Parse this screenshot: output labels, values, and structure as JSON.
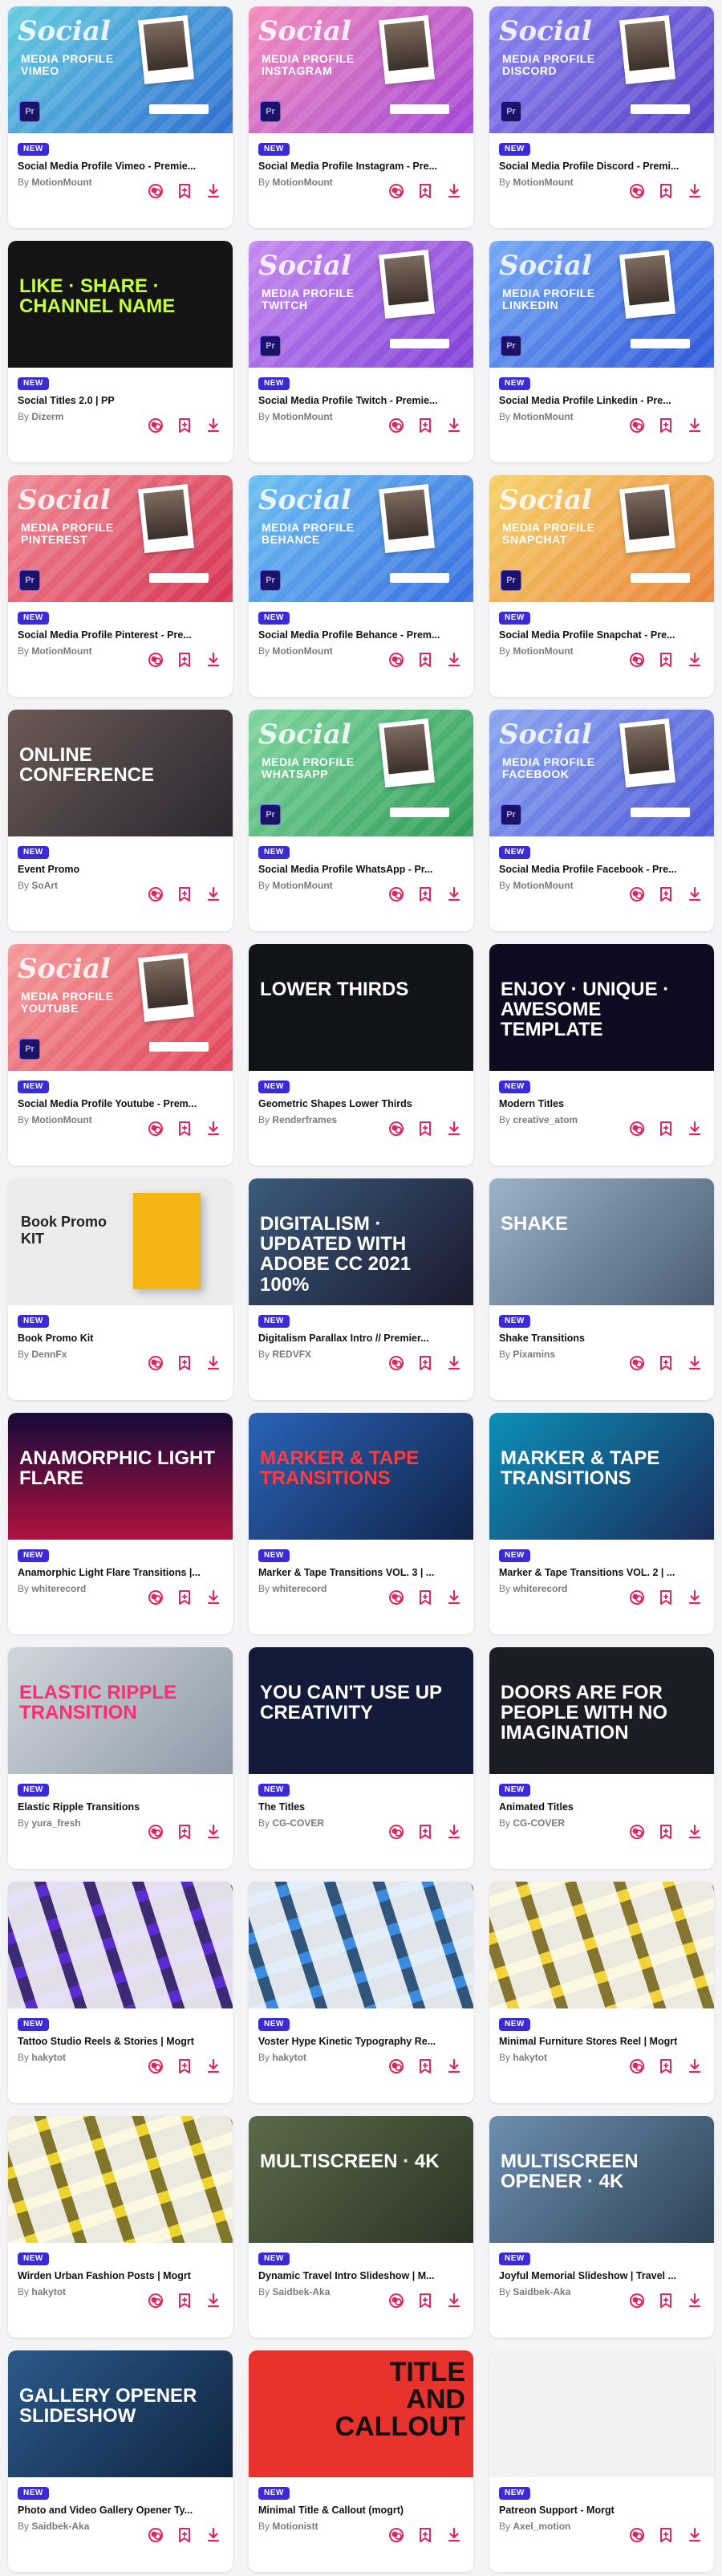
{
  "common": {
    "new_label": "NEW",
    "by_prefix": "By",
    "accent": "#e0245e",
    "badge_color": "#3b2bd6"
  },
  "items": [
    {
      "title": "Social Media Profile Vimeo - Premie...",
      "author": "MotionMount",
      "thumb": {
        "kind": "social",
        "bg": "linear-gradient(135deg,#66cde0,#2e6fd1)",
        "heading": "Social",
        "sub": "MEDIA PROFILE VIMEO"
      }
    },
    {
      "title": "Social Media Profile Instagram - Pre...",
      "author": "MotionMount",
      "thumb": {
        "kind": "social",
        "bg": "linear-gradient(135deg,#f58dbb,#a346d7)",
        "heading": "Social",
        "sub": "MEDIA PROFILE INSTAGRAM"
      }
    },
    {
      "title": "Social Media Profile Discord - Premi...",
      "author": "MotionMount",
      "thumb": {
        "kind": "social",
        "bg": "linear-gradient(135deg,#8b85f0,#5843c8)",
        "heading": "Social",
        "sub": "MEDIA PROFILE DISCORD"
      }
    },
    {
      "title": "Social Titles 2.0 | PP",
      "author": "Dizerm",
      "thumb": {
        "kind": "text",
        "bg": "#141414",
        "text": "LIKE · SHARE · CHANNEL NAME",
        "color": "#c6ff3a"
      }
    },
    {
      "title": "Social Media Profile Twitch - Premie...",
      "author": "MotionMount",
      "thumb": {
        "kind": "social",
        "bg": "linear-gradient(135deg,#c58af0,#8140d6)",
        "heading": "Social",
        "sub": "MEDIA PROFILE TWITCH"
      }
    },
    {
      "title": "Social Media Profile Linkedin - Pre...",
      "author": "MotionMount",
      "thumb": {
        "kind": "social",
        "bg": "linear-gradient(135deg,#74a8f5,#2f58d8)",
        "heading": "Social",
        "sub": "MEDIA PROFILE LINKEDIN"
      }
    },
    {
      "title": "Social Media Profile Pinterest - Pre...",
      "author": "MotionMount",
      "thumb": {
        "kind": "social",
        "bg": "linear-gradient(135deg,#f08a95,#d63452)",
        "heading": "Social",
        "sub": "MEDIA PROFILE PINTEREST"
      }
    },
    {
      "title": "Social Media Profile Behance - Prem...",
      "author": "MotionMount",
      "thumb": {
        "kind": "social",
        "bg": "linear-gradient(135deg,#6cc0f2,#3a6fe0)",
        "heading": "Social",
        "sub": "MEDIA PROFILE BEHANCE"
      }
    },
    {
      "title": "Social Media Profile Snapchat - Pre...",
      "author": "MotionMount",
      "thumb": {
        "kind": "social",
        "bg": "linear-gradient(135deg,#f7d26a,#e8843b)",
        "heading": "Social",
        "sub": "MEDIA PROFILE SNAPCHAT"
      }
    },
    {
      "title": "Event Promo",
      "author": "SoArt",
      "thumb": {
        "kind": "text",
        "bg": "linear-gradient(135deg,#6b5a54,#2b2730)",
        "text": "ONLINE CONFERENCE",
        "color": "#ffffff"
      }
    },
    {
      "title": "Social Media Profile WhatsApp - Pr...",
      "author": "MotionMount",
      "thumb": {
        "kind": "social",
        "bg": "linear-gradient(135deg,#7ed59e,#2f9d58)",
        "heading": "Social",
        "sub": "MEDIA PROFILE WHATSAPP"
      }
    },
    {
      "title": "Social Media Profile Facebook - Pre...",
      "author": "MotionMount",
      "thumb": {
        "kind": "social",
        "bg": "linear-gradient(135deg,#8aa6f0,#4f58d8)",
        "heading": "Social",
        "sub": "MEDIA PROFILE FACEBOOK"
      }
    },
    {
      "title": "Social Media Profile Youtube - Prem...",
      "author": "MotionMount",
      "thumb": {
        "kind": "social",
        "bg": "linear-gradient(135deg,#f49a9a,#e0455a)",
        "heading": "Social",
        "sub": "MEDIA PROFILE YOUTUBE"
      }
    },
    {
      "title": "Geometric Shapes Lower Thirds",
      "author": "Renderframes",
      "thumb": {
        "kind": "text",
        "bg": "#101418",
        "text": "LOWER THIRDS",
        "color": "#ffffff"
      }
    },
    {
      "title": "Modern Titles",
      "author": "creative_atom",
      "thumb": {
        "kind": "text",
        "bg": "#0e0b20",
        "text": "ENJOY · UNIQUE · AWESOME TEMPLATE",
        "color": "#ffffff"
      }
    },
    {
      "title": "Book Promo Kit",
      "author": "DennFx",
      "thumb": {
        "kind": "book",
        "bg": "#ececec",
        "text": "Book Promo KIT",
        "color": "#222222"
      }
    },
    {
      "title": "Digitalism Parallax Intro // Premier...",
      "author": "REDVFX",
      "thumb": {
        "kind": "text",
        "bg": "linear-gradient(135deg,#3b5a7a,#1a1a2e)",
        "text": "DIGITALISM · UPDATED WITH ADOBE CC 2021 100%",
        "color": "#ffffff"
      }
    },
    {
      "title": "Shake Transitions",
      "author": "Pixamins",
      "thumb": {
        "kind": "text",
        "bg": "linear-gradient(135deg,#9bb3c9,#4a5c72)",
        "text": "Shake",
        "color": "#ffffff"
      }
    },
    {
      "title": "Anamorphic Light Flare Transitions |...",
      "author": "whiterecord",
      "thumb": {
        "kind": "text",
        "bg": "linear-gradient(180deg,#140a3a,#b0123f)",
        "text": "ANAMORPHIC LIGHT FLARE",
        "color": "#ffffff"
      }
    },
    {
      "title": "Marker & Tape Transitions VOL. 3 | ...",
      "author": "whiterecord",
      "thumb": {
        "kind": "text",
        "bg": "linear-gradient(135deg,#2a63b8,#0f2347)",
        "text": "MARKER & TAPE TRANSITIONS",
        "color": "#ff3b3b"
      }
    },
    {
      "title": "Marker & Tape Transitions VOL. 2 | ...",
      "author": "whiterecord",
      "thumb": {
        "kind": "text",
        "bg": "linear-gradient(135deg,#0c8fb8,#1b2c5a)",
        "text": "MARKER & TAPE TRANSITIONS",
        "color": "#ffffff"
      }
    },
    {
      "title": "Elastic Ripple Transitions",
      "author": "yura_fresh",
      "thumb": {
        "kind": "text",
        "bg": "linear-gradient(135deg,#cfd7de,#8f9aa6)",
        "text": "Elastic Ripple Transition",
        "color": "#ff2d6f"
      }
    },
    {
      "title": "The Titles",
      "author": "CG-COVER",
      "thumb": {
        "kind": "text",
        "bg": "#131a3a",
        "text": "YOU CAN'T USE UP CREATIVITY",
        "color": "#ffffff"
      }
    },
    {
      "title": "Animated Titles",
      "author": "CG-COVER",
      "thumb": {
        "kind": "text",
        "bg": "#1a1d24",
        "text": "DOORS ARE FOR PEOPLE WITH NO IMAGINATION",
        "color": "#ffffff"
      }
    },
    {
      "title": "Tattoo Studio Reels & Stories | Mogrt",
      "author": "hakytot",
      "thumb": {
        "kind": "tiles",
        "bg": "#5a2bd1",
        "text": "",
        "color": "#ffffff"
      }
    },
    {
      "title": "Voster Hype Kinetic Typography Re...",
      "author": "hakytot",
      "thumb": {
        "kind": "tiles",
        "bg": "#3b8be0",
        "text": "",
        "color": "#ffffff"
      }
    },
    {
      "title": "Minimal Furniture Stores Reel | Mogrt",
      "author": "hakytot",
      "thumb": {
        "kind": "tiles",
        "bg": "#f4d23a",
        "text": "",
        "color": "#ffffff"
      }
    },
    {
      "title": "Wirden Urban Fashion Posts | Mogrt",
      "author": "hakytot",
      "thumb": {
        "kind": "tiles",
        "bg": "#f0d42e",
        "text": "",
        "color": "#ffffff"
      }
    },
    {
      "title": "Dynamic Travel Intro Slideshow | M...",
      "author": "Saidbek-Aka",
      "thumb": {
        "kind": "text",
        "bg": "linear-gradient(135deg,#5a6a4a,#2a3424)",
        "text": "MULTISCREEN · 4K",
        "color": "#ffffff"
      }
    },
    {
      "title": "Joyful Memorial Slideshow | Travel ...",
      "author": "Saidbek-Aka",
      "thumb": {
        "kind": "text",
        "bg": "linear-gradient(135deg,#6c8fb0,#2f4358)",
        "text": "MULTISCREEN OPENER · 4K",
        "color": "#ffffff"
      }
    },
    {
      "title": "Photo and Video Gallery Opener Ty...",
      "author": "Saidbek-Aka",
      "thumb": {
        "kind": "text",
        "bg": "linear-gradient(135deg,#2a5a8a,#0f2440)",
        "text": "GALLERY OPENER SLIDESHOW",
        "color": "#ffffff"
      }
    },
    {
      "title": "Minimal Title & Callout (mogrt)",
      "author": "Motionistt",
      "thumb": {
        "kind": "callout",
        "bg": "#e8322e",
        "text": "TITLE AND CALLOUT",
        "color": "#111111"
      }
    },
    {
      "title": "Patreon Support - Morgt",
      "author": "Axel_motion",
      "thumb": {
        "kind": "text",
        "bg": "#f2f2f2",
        "text": "",
        "color": "#e0245e"
      }
    }
  ]
}
